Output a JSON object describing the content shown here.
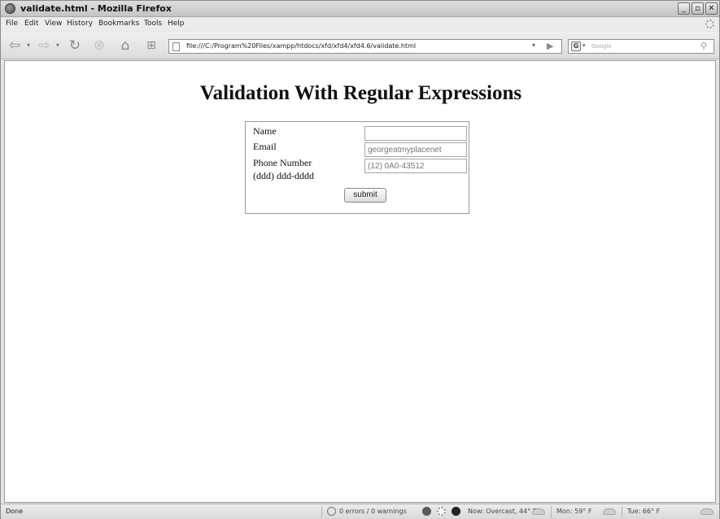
{
  "window": {
    "title": "validate.html - Mozilla Firefox",
    "controls": {
      "minimize": "_",
      "maximize": "▫",
      "close": "✕"
    }
  },
  "menu": [
    "File",
    "Edit",
    "View",
    "History",
    "Bookmarks",
    "Tools",
    "Help"
  ],
  "toolbar": {
    "url": "file:///C:/Program%20Files/xampp/htdocs/xfd/xfd4/xfd4.6/validate.html",
    "search_placeholder": "Google",
    "search_engine_icon": "G",
    "icons": [
      "back-icon",
      "forward-icon",
      "reload-icon",
      "stop-icon",
      "home-icon",
      "new-tab-icon",
      "go-icon",
      "search-icon"
    ]
  },
  "page": {
    "heading": "Validation With Regular Expressions",
    "form": {
      "name_label": "Name",
      "name_value": "",
      "email_label": "Email",
      "email_value": "georgeatmyplacenet",
      "phone_label": "Phone Number",
      "phone_format": "(ddd) ddd-dddd",
      "phone_value": "(12) 0A0-43512",
      "submit_label": "submit"
    }
  },
  "statusbar": {
    "status": "Done",
    "validator": "0 errors / 0 warnings",
    "weather_now": "Now: Overcast, 44° F",
    "weather_mon": "Mon: 59° F",
    "weather_tue": "Tue: 66° F"
  }
}
